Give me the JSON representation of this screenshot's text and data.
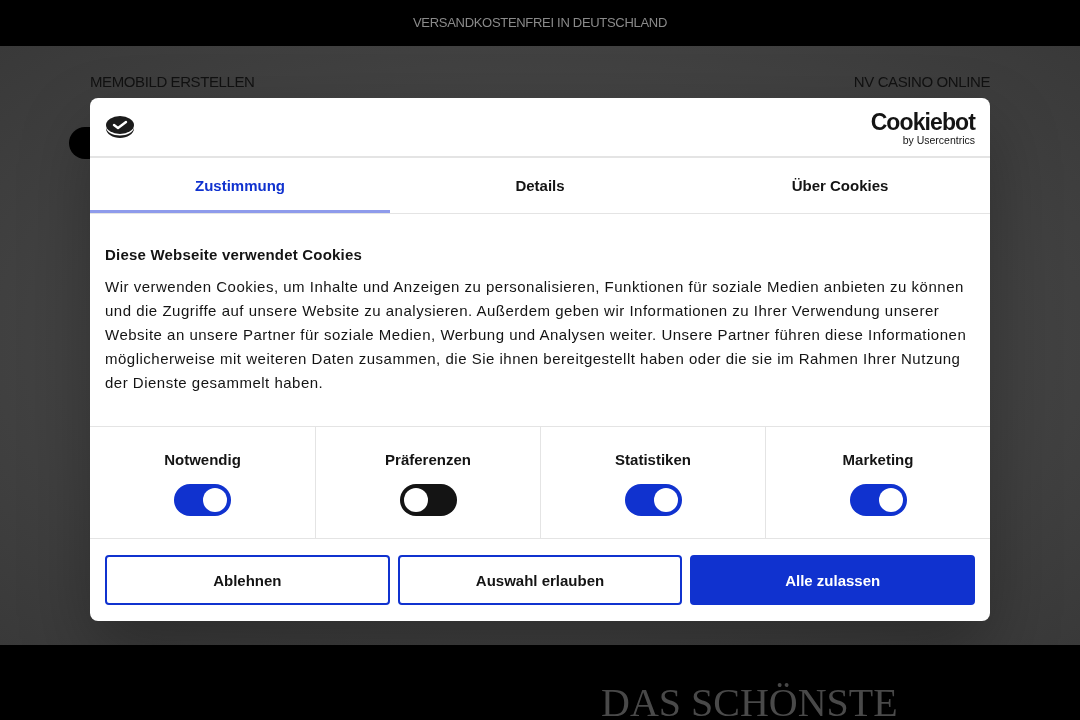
{
  "announcement_bar": {
    "text": "VERSANDKOSTENFREI IN DEUTSCHLAND"
  },
  "nav": {
    "links": [
      "MEMOBILD ERSTELLEN",
      "NV CASINO ONLINE"
    ]
  },
  "hero": {
    "heading": "DAS SCHÖNSTE"
  },
  "cookie_dialog": {
    "brand": {
      "name": "Cookiebot",
      "tagline": "by Usercentrics"
    },
    "tabs": [
      {
        "label": "Zustimmung",
        "selected": true
      },
      {
        "label": "Details",
        "selected": false
      },
      {
        "label": "Über Cookies",
        "selected": false
      }
    ],
    "title": "Diese Webseite verwendet Cookies",
    "body": "Wir verwenden Cookies, um Inhalte und Anzeigen zu personalisieren, Funktionen für soziale Medien anbieten zu können und die Zugriffe auf unsere Website zu analysieren. Außerdem geben wir Informationen zu Ihrer Verwendung unserer Website an unsere Partner für soziale Medien, Werbung und Analysen weiter. Unsere Partner führen diese Informationen möglicherweise mit weiteren Daten zusammen, die Sie ihnen bereitgestellt haben oder die sie im Rahmen Ihrer Nutzung der Dienste gesammelt haben.",
    "categories": [
      {
        "label": "Notwendig",
        "on": true
      },
      {
        "label": "Präferenzen",
        "on": false
      },
      {
        "label": "Statistiken",
        "on": true
      },
      {
        "label": "Marketing",
        "on": true
      }
    ],
    "buttons": [
      {
        "label": "Ablehnen",
        "kind": "outline"
      },
      {
        "label": "Auswahl erlauben",
        "kind": "outline"
      },
      {
        "label": "Alle zulassen",
        "kind": "filled"
      }
    ]
  }
}
